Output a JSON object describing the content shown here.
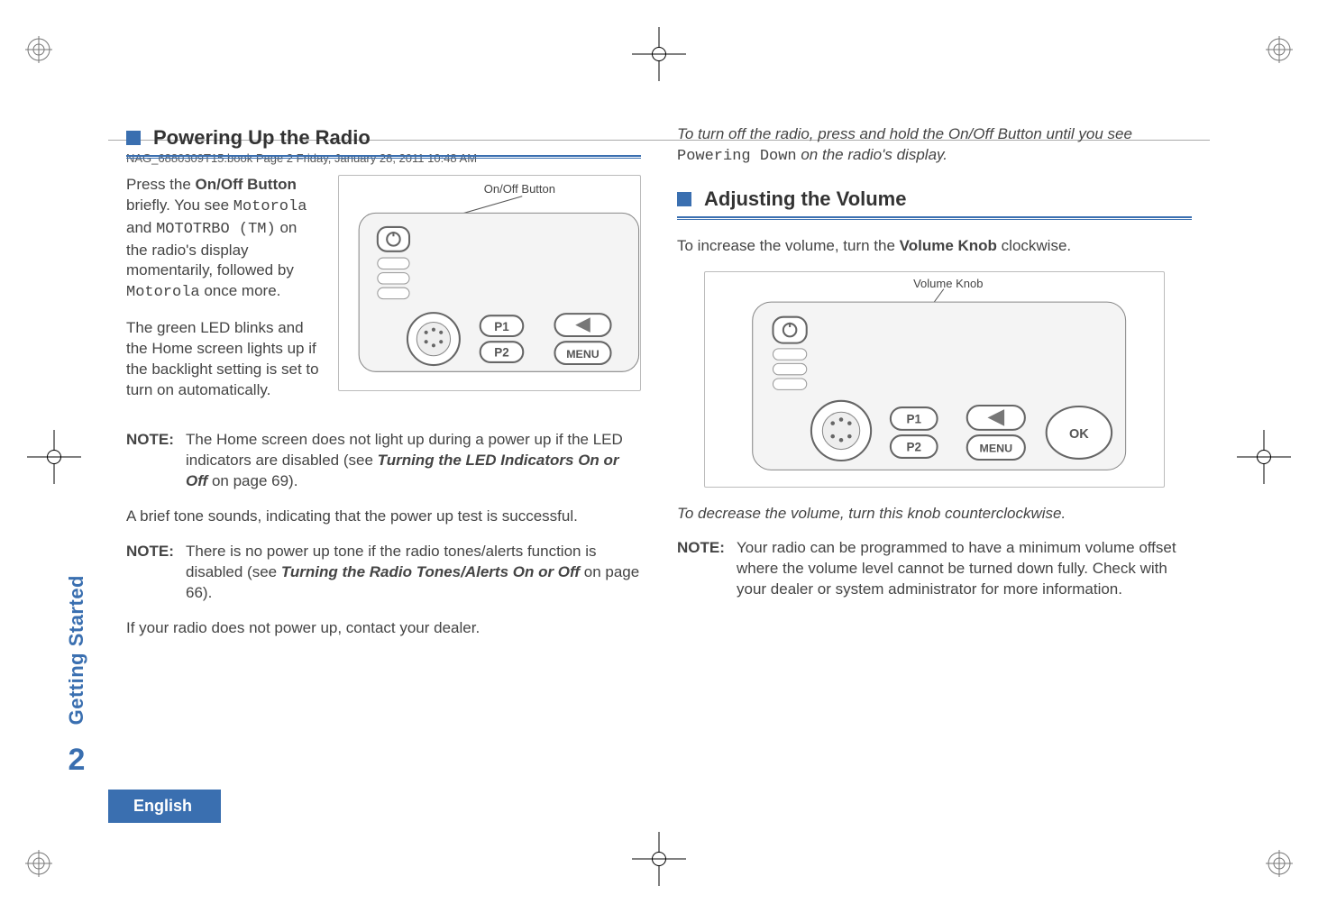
{
  "header": {
    "running_head": "NAG_6880309T15.book  Page 2  Friday, January 28, 2011  10:48 AM"
  },
  "sidebar": {
    "section_label": "Getting Started",
    "page_number": "2"
  },
  "language_tag": "English",
  "left_column": {
    "title": "Powering Up the Radio",
    "p1_pre": "Press the ",
    "p1_bold": "On/Off Button",
    "p1_post1": " briefly. You see ",
    "p1_code1": "Motorola",
    "p1_post2": " and ",
    "p1_code2": "MOTOTRBO (TM)",
    "p1_post3": " on the radio's display momentarily, followed by ",
    "p1_code3": "Motorola",
    "p1_post4": " once more.",
    "p2": "The green LED blinks and the Home screen lights up if the backlight setting is set to turn on automatically.",
    "figure1_label": "On/Off Button",
    "note1_lbl": "NOTE:",
    "note1_text_pre": "The Home screen does not light up during a power up if the LED indicators are disabled (see ",
    "note1_italic": "Turning the LED Indicators On or Off",
    "note1_text_post": " on page 69).",
    "p3": "A brief tone sounds, indicating that the power up test is successful.",
    "note2_lbl": "NOTE:",
    "note2_text_pre": "There is no power up tone if the radio tones/alerts function is disabled (see ",
    "note2_italic": "Turning the Radio Tones/Alerts On or Off",
    "note2_text_post": " on page 66).",
    "p4": "If your radio does not power up, contact your dealer."
  },
  "right_column": {
    "p0_pre": "To turn off the radio, press and hold the On/Off Button until you see ",
    "p0_code": "Powering Down",
    "p0_post": " on the radio's display.",
    "title": "Adjusting the Volume",
    "p1_pre": "To increase the volume, turn the ",
    "p1_bold": "Volume Knob",
    "p1_post": " clockwise.",
    "figure2_label": "Volume Knob",
    "p2": "To decrease the volume, turn this knob counterclockwise.",
    "note1_lbl": "NOTE:",
    "note1_text": "Your radio can be programmed to have a minimum volume offset where the volume level cannot be turned down fully. Check with your dealer or system administrator for more information."
  },
  "figure_buttons": {
    "p1": "P1",
    "p2": "P2",
    "menu": "MENU",
    "ok": "OK"
  }
}
